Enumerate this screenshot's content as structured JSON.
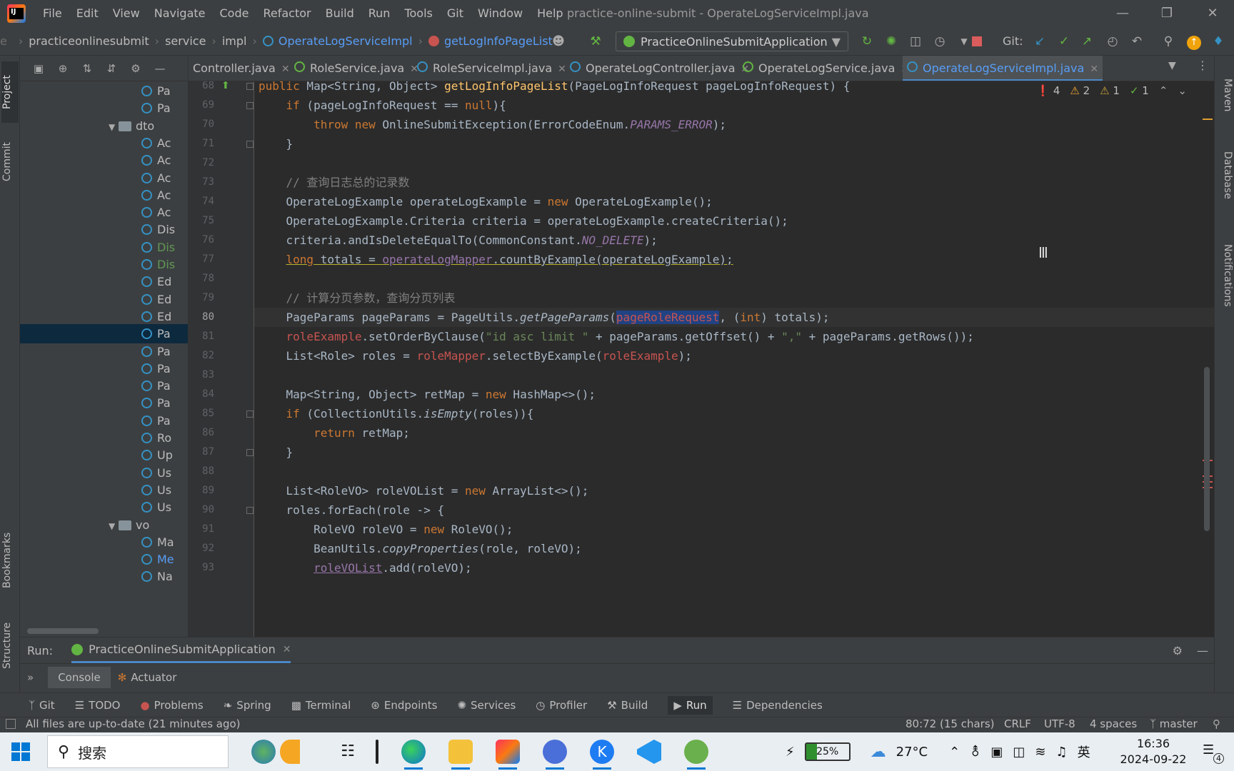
{
  "menubar": {
    "items": [
      "File",
      "Edit",
      "View",
      "Navigate",
      "Code",
      "Refactor",
      "Build",
      "Run",
      "Tools",
      "Git",
      "Window",
      "Help"
    ],
    "window_title": "practice-online-submit - OperateLogServiceImpl.java"
  },
  "navbar": {
    "breadcrumbs": [
      "practiceonlinesubmit",
      "service",
      "impl",
      "OperateLogServiceImpl",
      "getLogInfoPageList"
    ],
    "run_config": "PracticeOnlineSubmitApplication",
    "git_label": "Git:"
  },
  "left_strip": {
    "project": "Project",
    "commit": "Commit",
    "bookmarks": "Bookmarks",
    "structure": "Structure"
  },
  "right_strip": {
    "maven": "Maven",
    "database": "Database",
    "notifications": "Notifications"
  },
  "project_tree": [
    {
      "label": "Pa",
      "kind": "class"
    },
    {
      "label": "Pa",
      "kind": "class"
    },
    {
      "label": "dto",
      "kind": "folder"
    },
    {
      "label": "Ac",
      "kind": "class"
    },
    {
      "label": "Ac",
      "kind": "class"
    },
    {
      "label": "Ac",
      "kind": "class"
    },
    {
      "label": "Ac",
      "kind": "class"
    },
    {
      "label": "Ac",
      "kind": "class"
    },
    {
      "label": "Dis",
      "kind": "class"
    },
    {
      "label": "Dis",
      "kind": "class-green"
    },
    {
      "label": "Dis",
      "kind": "class-green"
    },
    {
      "label": "Ed",
      "kind": "class"
    },
    {
      "label": "Ed",
      "kind": "class"
    },
    {
      "label": "Ed",
      "kind": "class"
    },
    {
      "label": "Pa",
      "kind": "class-selected"
    },
    {
      "label": "Pa",
      "kind": "class"
    },
    {
      "label": "Pa",
      "kind": "class"
    },
    {
      "label": "Pa",
      "kind": "class"
    },
    {
      "label": "Pa",
      "kind": "class"
    },
    {
      "label": "Pa",
      "kind": "class"
    },
    {
      "label": "Ro",
      "kind": "class"
    },
    {
      "label": "Up",
      "kind": "class"
    },
    {
      "label": "Us",
      "kind": "class"
    },
    {
      "label": "Us",
      "kind": "class"
    },
    {
      "label": "Us",
      "kind": "class"
    },
    {
      "label": "vo",
      "kind": "folder"
    },
    {
      "label": "Ma",
      "kind": "class"
    },
    {
      "label": "Me",
      "kind": "class-blue"
    },
    {
      "label": "Na",
      "kind": "class"
    }
  ],
  "tabs": [
    {
      "label": "Controller.java",
      "kind": "class"
    },
    {
      "label": "RoleService.java",
      "kind": "interface"
    },
    {
      "label": "RoleServiceImpl.java",
      "kind": "class"
    },
    {
      "label": "OperateLogController.java",
      "kind": "class"
    },
    {
      "label": "OperateLogService.java",
      "kind": "interface"
    },
    {
      "label": "OperateLogServiceImpl.java",
      "kind": "class",
      "active": true
    }
  ],
  "inspection": {
    "errors": "4",
    "warnings": "2",
    "weak_warnings": "1",
    "ok": "1"
  },
  "editor": {
    "current_line": "80",
    "lines": [
      {
        "n": "68",
        "html": "<span class='kw'>public</span> Map&lt;String, Object&gt; <span class='fn'>getLogInfoPageList</span>(PageLogInfoRequest pageLogInfoRequest) {"
      },
      {
        "n": "69",
        "html": "    <span class='kw'>if</span> (pageLogInfoRequest == <span class='kw'>null</span>){"
      },
      {
        "n": "70",
        "html": "        <span class='kw'>throw new</span> OnlineSubmitException(ErrorCodeEnum.<span class='cst'>PARAMS_ERROR</span>);"
      },
      {
        "n": "71",
        "html": "    }"
      },
      {
        "n": "72",
        "html": ""
      },
      {
        "n": "73",
        "html": "    <span class='cm'>// 查询日志总的记录数</span>"
      },
      {
        "n": "74",
        "html": "    OperateLogExample operateLogExample = <span class='kw'>new</span> OperateLogExample();"
      },
      {
        "n": "75",
        "html": "    OperateLogExample.Criteria criteria = operateLogExample.createCriteria();"
      },
      {
        "n": "76",
        "html": "    criteria.andIsDeleteEqualTo(CommonConstant.<span class='cst'>NO_DELETE</span>);"
      },
      {
        "n": "77",
        "html": "    <span class='uline'><span class='kw'>long</span> totals = <span class='fld'>operateLogMapper</span>.countByExample(operateLogExample);</span>"
      },
      {
        "n": "78",
        "html": ""
      },
      {
        "n": "79",
        "html": "    <span class='cm'>// 计算分页参数，查询分页列表</span>"
      },
      {
        "n": "80",
        "html": "    PageParams pageParams = PageUtils.<span class='itf'>getPageParams</span>(<span class='sel-text warn'>pageRoleRequest</span>, (<span class='kw'>int</span>) totals);"
      },
      {
        "n": "81",
        "html": "    <span class='warn'>roleExample</span>.setOrderByClause(<span class='st'>\"id asc limit \"</span> + pageParams.getOffset() + <span class='st'>\",\"</span> + pageParams.getRows());"
      },
      {
        "n": "82",
        "html": "    List&lt;Role&gt; roles = <span class='warn'>roleMapper</span>.selectByExample(<span class='warn'>roleExample</span>);"
      },
      {
        "n": "83",
        "html": ""
      },
      {
        "n": "84",
        "html": "    Map&lt;String, Object&gt; retMap = <span class='kw'>new</span> HashMap&lt;&gt;();"
      },
      {
        "n": "85",
        "html": "    <span class='kw'>if</span> (CollectionUtils.<span class='itf'>isEmpty</span>(roles)){"
      },
      {
        "n": "86",
        "html": "        <span class='kw'>return</span> retMap;"
      },
      {
        "n": "87",
        "html": "    }"
      },
      {
        "n": "88",
        "html": ""
      },
      {
        "n": "89",
        "html": "    List&lt;RoleVO&gt; roleVOList = <span class='kw'>new</span> ArrayList&lt;&gt;();"
      },
      {
        "n": "90",
        "html": "    roles.forEach(role -&gt; {"
      },
      {
        "n": "91",
        "html": "        RoleVO roleVO = <span class='kw'>new</span> RoleVO();"
      },
      {
        "n": "92",
        "html": "        BeanUtils.<span class='itf'>copyProperties</span>(role, roleVO);"
      },
      {
        "n": "93",
        "html": "        <span style='text-decoration:underline' class='fld'>roleVOList</span>.add(roleVO);"
      }
    ]
  },
  "run_panel": {
    "label": "Run:",
    "app": "PracticeOnlineSubmitApplication",
    "tabs": [
      "Console",
      "Actuator"
    ]
  },
  "bottom_tools": [
    "Git",
    "TODO",
    "Problems",
    "Spring",
    "Terminal",
    "Endpoints",
    "Services",
    "Profiler",
    "Build",
    "Run",
    "Dependencies"
  ],
  "statusbar": {
    "message": "All files are up-to-date (21 minutes ago)",
    "position": "80:72 (15 chars)",
    "line_sep": "CRLF",
    "encoding": "UTF-8",
    "indent": "4 spaces",
    "branch": "master"
  },
  "taskbar": {
    "search_placeholder": "搜索",
    "battery": "25%",
    "weather": "27°C",
    "ime": "英",
    "time": "16:36",
    "date": "2024-09-22",
    "notifications": "4"
  }
}
